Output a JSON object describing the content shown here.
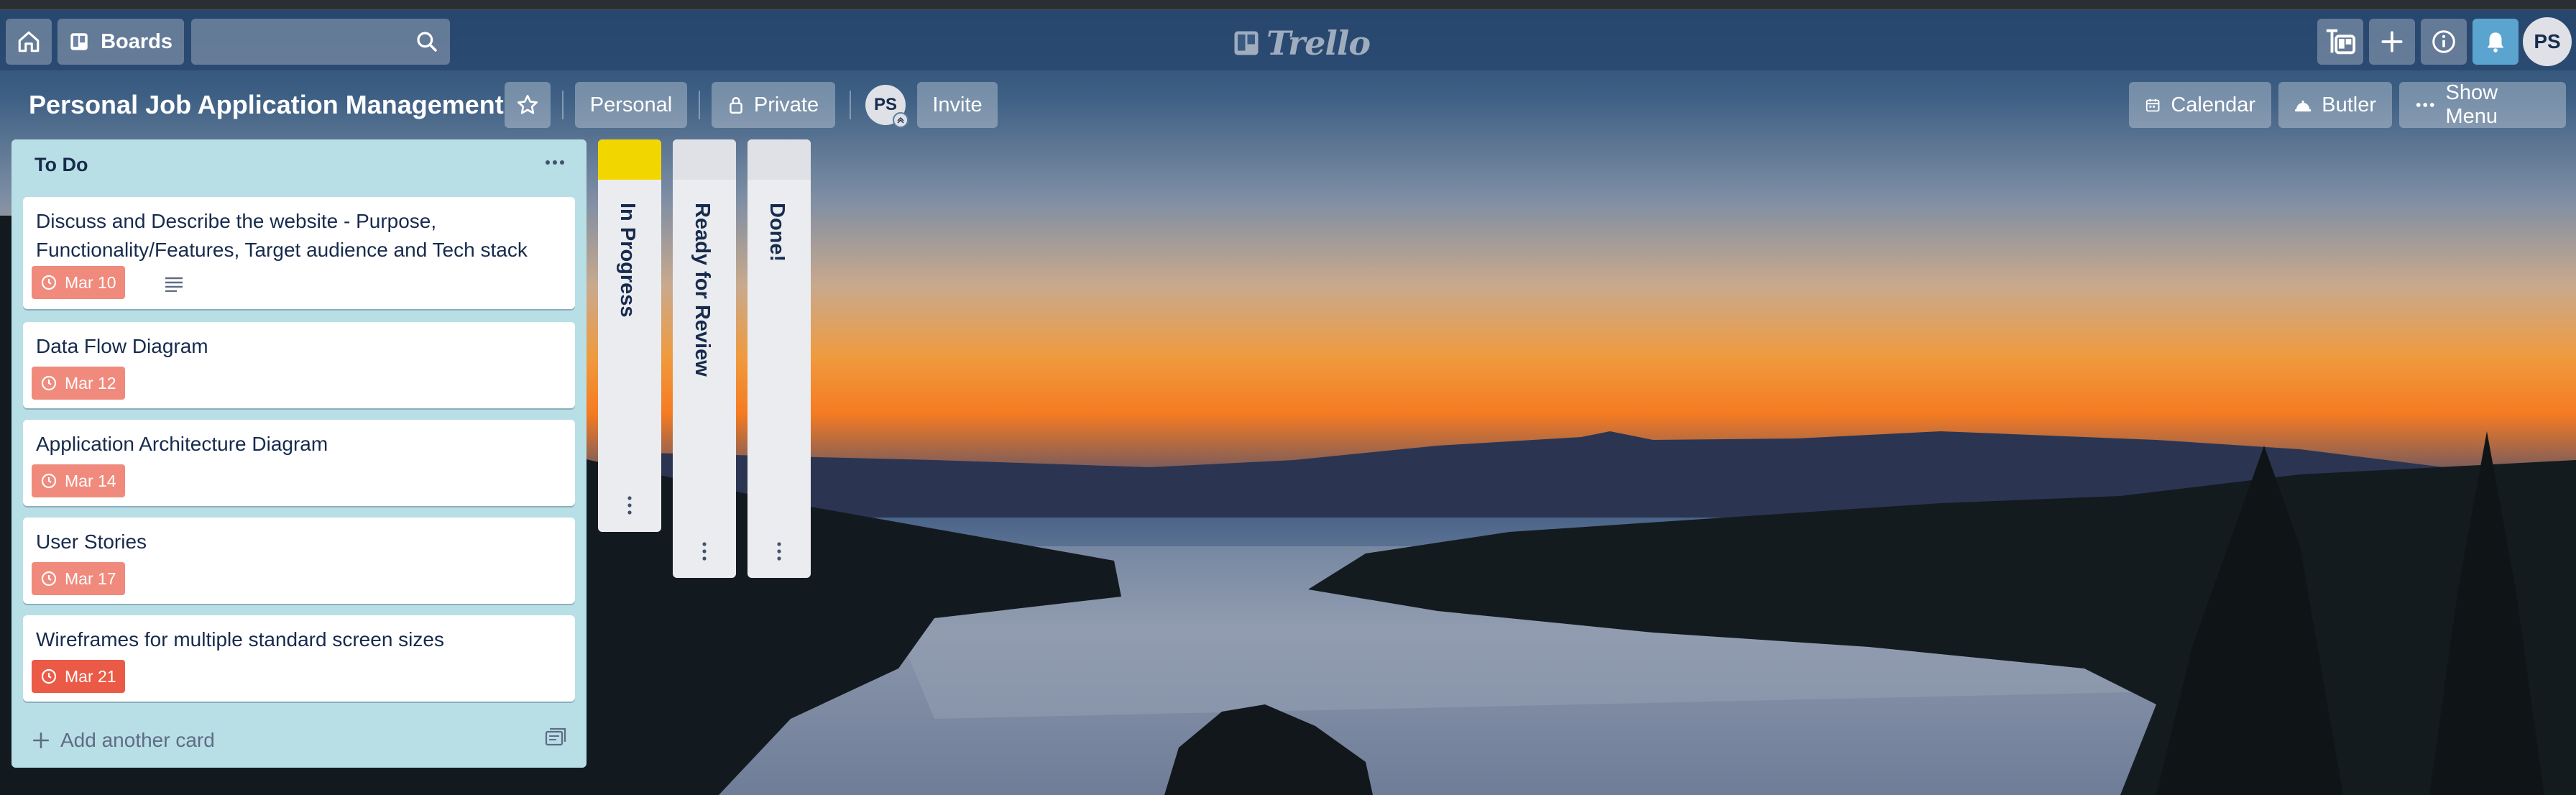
{
  "header": {
    "boards_label": "Boards",
    "search_placeholder": "",
    "logo_text": "Trello",
    "user_initials": "PS"
  },
  "board": {
    "title": "Personal Job Application Management",
    "team_label": "Personal",
    "visibility_label": "Private",
    "member_initials": "PS",
    "invite_label": "Invite",
    "calendar_label": "Calendar",
    "butler_label": "Butler",
    "show_menu_label": "Show Menu"
  },
  "lists": [
    {
      "name": "To Do",
      "add_card_label": "Add another card",
      "cards": [
        {
          "title": "Discuss and Describe the website - Purpose, Functionality/Features, Target audience and Tech stack",
          "due": "Mar 10",
          "has_description": true
        },
        {
          "title": "Data Flow Diagram",
          "due": "Mar 12",
          "has_description": false
        },
        {
          "title": "Application Architecture Diagram",
          "due": "Mar 14",
          "has_description": false
        },
        {
          "title": "User Stories",
          "due": "Mar 17",
          "has_description": false
        },
        {
          "title": "Wireframes for multiple standard screen sizes",
          "due": "Mar 21",
          "has_description": false
        }
      ]
    },
    {
      "name": "In Progress",
      "collapsed": true,
      "label_color": "#f2d600"
    },
    {
      "name": "Ready for Review",
      "collapsed": true,
      "label_color": "#dfe1e6"
    },
    {
      "name": "Done!",
      "collapsed": true,
      "label_color": "#dfe1e6"
    }
  ],
  "colors": {
    "header_bg": "#2a4b74",
    "list_bg": "#b9dfe6",
    "due_badge": "#eb5a46",
    "notification": "#5ba4cf"
  }
}
